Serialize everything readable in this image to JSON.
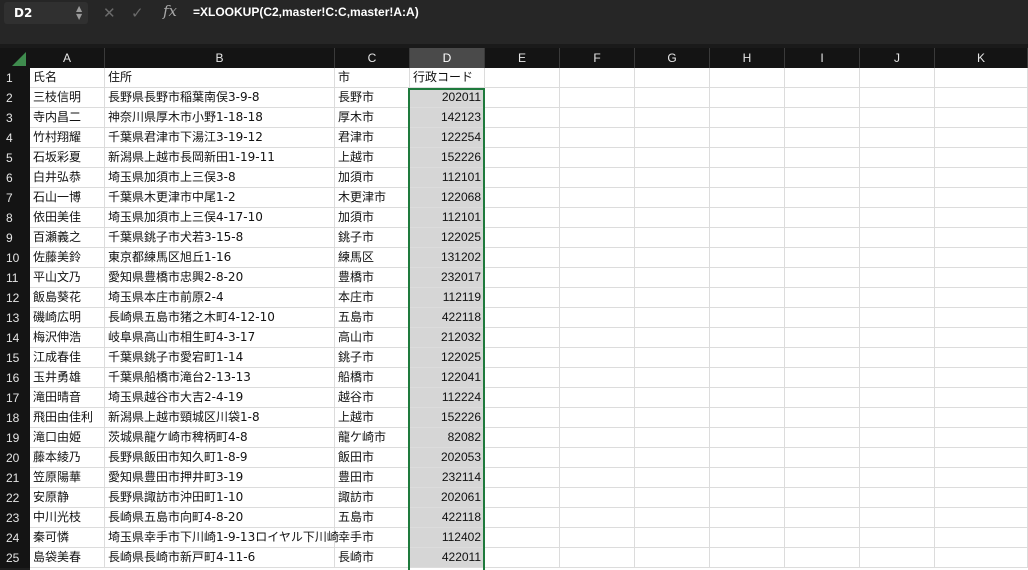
{
  "formula_bar": {
    "name_box": "D2",
    "cancel_icon": "✕",
    "enter_icon": "✓",
    "fx_label": "fx",
    "formula": "=XLOOKUP(C2,master!C:C,master!A:A)"
  },
  "columns": [
    "A",
    "B",
    "C",
    "D",
    "E",
    "F",
    "G",
    "H",
    "I",
    "J",
    "K"
  ],
  "selected_column": "D",
  "header_row": {
    "row_number": "1",
    "a": "氏名",
    "b": "住所",
    "c": "市",
    "d": "行政コード"
  },
  "rows": [
    {
      "n": "2",
      "a": "三枝信明",
      "b": "長野県長野市稲葉南俣3-9-8",
      "c": "長野市",
      "d": "202011"
    },
    {
      "n": "3",
      "a": "寺内昌二",
      "b": "神奈川県厚木市小野1-18-18",
      "c": "厚木市",
      "d": "142123"
    },
    {
      "n": "4",
      "a": "竹村翔耀",
      "b": "千葉県君津市下湯江3-19-12",
      "c": "君津市",
      "d": "122254"
    },
    {
      "n": "5",
      "a": "石坂彩夏",
      "b": "新潟県上越市長岡新田1-19-11",
      "c": "上越市",
      "d": "152226"
    },
    {
      "n": "6",
      "a": "白井弘恭",
      "b": "埼玉県加須市上三俣3-8",
      "c": "加須市",
      "d": "112101"
    },
    {
      "n": "7",
      "a": "石山一博",
      "b": "千葉県木更津市中尾1-2",
      "c": "木更津市",
      "d": "122068"
    },
    {
      "n": "8",
      "a": "依田美佳",
      "b": "埼玉県加須市上三俣4-17-10",
      "c": "加須市",
      "d": "112101"
    },
    {
      "n": "9",
      "a": "百瀬義之",
      "b": "千葉県銚子市犬若3-15-8",
      "c": "銚子市",
      "d": "122025"
    },
    {
      "n": "10",
      "a": "佐藤美鈴",
      "b": "東京都練馬区旭丘1-16",
      "c": "練馬区",
      "d": "131202"
    },
    {
      "n": "11",
      "a": "平山文乃",
      "b": "愛知県豊橋市忠興2-8-20",
      "c": "豊橋市",
      "d": "232017"
    },
    {
      "n": "12",
      "a": "飯島葵花",
      "b": "埼玉県本庄市前原2-4",
      "c": "本庄市",
      "d": "112119"
    },
    {
      "n": "13",
      "a": "磯崎広明",
      "b": "長崎県五島市猪之木町4-12-10",
      "c": "五島市",
      "d": "422118"
    },
    {
      "n": "14",
      "a": "梅沢伸浩",
      "b": "岐阜県高山市相生町4-3-17",
      "c": "高山市",
      "d": "212032"
    },
    {
      "n": "15",
      "a": "江成春佳",
      "b": "千葉県銚子市愛宕町1-14",
      "c": "銚子市",
      "d": "122025"
    },
    {
      "n": "16",
      "a": "玉井勇雄",
      "b": "千葉県船橋市滝台2-13-13",
      "c": "船橋市",
      "d": "122041"
    },
    {
      "n": "17",
      "a": "滝田晴音",
      "b": "埼玉県越谷市大吉2-4-19",
      "c": "越谷市",
      "d": "112224"
    },
    {
      "n": "18",
      "a": "飛田由佳利",
      "b": "新潟県上越市頸城区川袋1-8",
      "c": "上越市",
      "d": "152226"
    },
    {
      "n": "19",
      "a": "滝口由姫",
      "b": "茨城県龍ケ崎市稗柄町4-8",
      "c": "龍ケ崎市",
      "d": "82082"
    },
    {
      "n": "20",
      "a": "藤本綾乃",
      "b": "長野県飯田市知久町1-8-9",
      "c": "飯田市",
      "d": "202053"
    },
    {
      "n": "21",
      "a": "笠原陽華",
      "b": "愛知県豊田市押井町3-19",
      "c": "豊田市",
      "d": "232114"
    },
    {
      "n": "22",
      "a": "安原静",
      "b": "長野県諏訪市沖田町1-10",
      "c": "諏訪市",
      "d": "202061"
    },
    {
      "n": "23",
      "a": "中川光枝",
      "b": "長崎県五島市向町4-8-20",
      "c": "五島市",
      "d": "422118"
    },
    {
      "n": "24",
      "a": "秦可憐",
      "b": "埼玉県幸手市下川崎1-9-13ロイヤル下川崎",
      "c": "幸手市",
      "d": "112402"
    },
    {
      "n": "25",
      "a": "島袋美春",
      "b": "長崎県長崎市新戸町4-11-6",
      "c": "長崎市",
      "d": "422011"
    }
  ]
}
